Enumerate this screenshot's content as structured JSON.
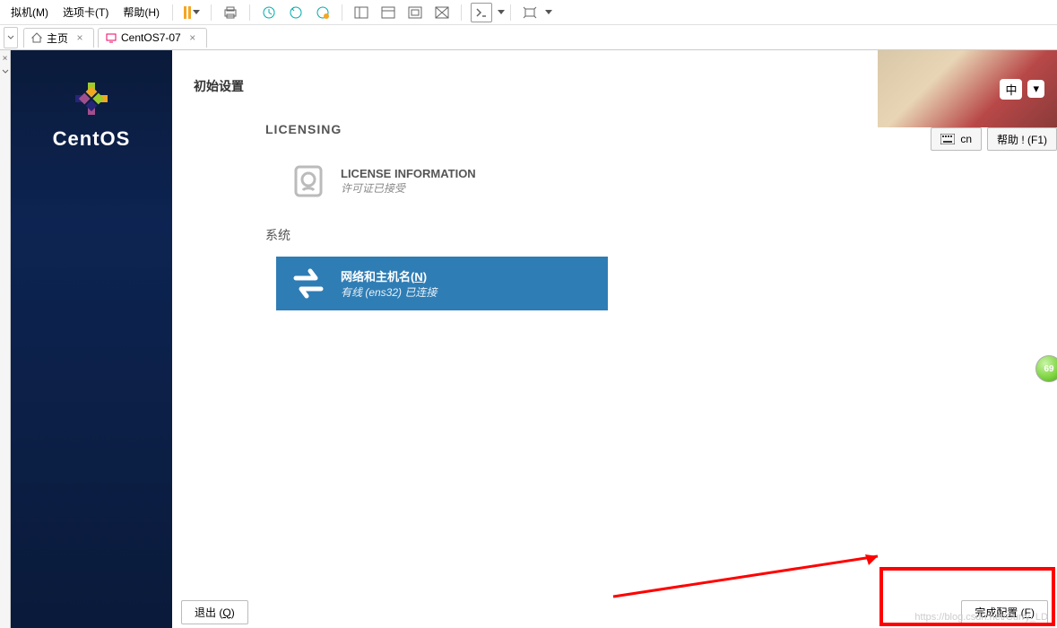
{
  "menubar": {
    "items": [
      "拟机(M)",
      "选项卡(T)",
      "帮助(H)"
    ]
  },
  "tabs": {
    "home": "主页",
    "vm": "CentOS7-07"
  },
  "centos": {
    "brand": "CentOS"
  },
  "installer": {
    "page_title": "初始设置",
    "licensing_header": "LICENSING",
    "license": {
      "title": "LICENSE INFORMATION",
      "status": "许可证已接受"
    },
    "system_header": "系统",
    "network": {
      "title_prefix": "网络和主机名(",
      "title_key": "N",
      "title_suffix": ")",
      "status": "有线 (ens32) 已连接"
    },
    "buttons": {
      "quit_prefix": "退出 (",
      "quit_key": "Q",
      "quit_suffix": ")",
      "finish_prefix": "完成配置 (",
      "finish_key": "F",
      "finish_suffix": ")"
    }
  },
  "overlay": {
    "cn_badge": "中",
    "keyboard": "cn",
    "help": "帮助 !  (F1)"
  },
  "badge": {
    "value": "69"
  },
  "watermark": "https://blog.csdn.net/Curry_LD"
}
